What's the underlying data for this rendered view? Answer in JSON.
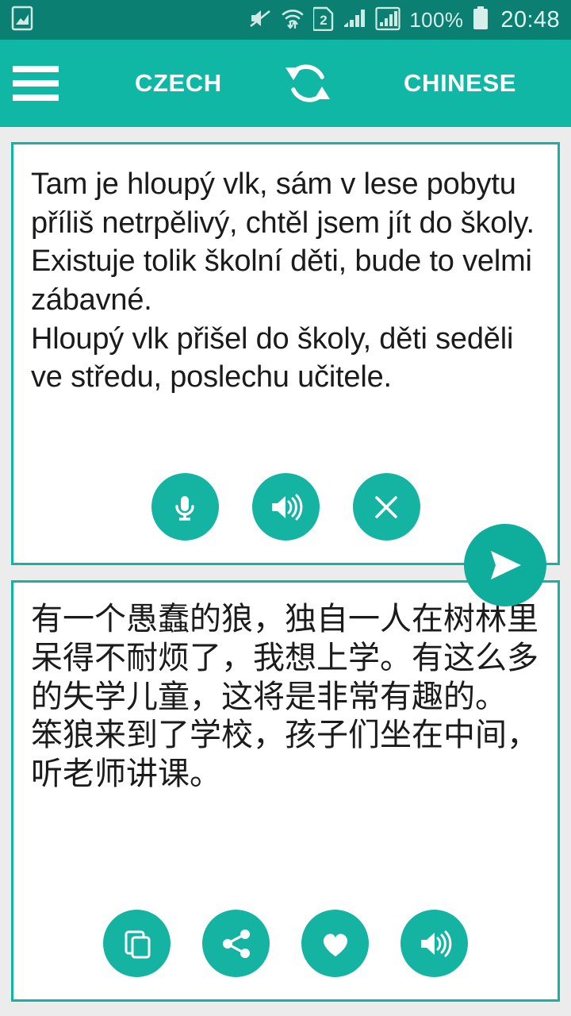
{
  "status_bar": {
    "icons": [
      {
        "name": "screenshot-icon",
        "label": "screenshot"
      },
      {
        "name": "mute-icon",
        "label": "sound muted"
      },
      {
        "name": "wifi-transfer-icon",
        "label": "wifi with data transfer"
      },
      {
        "name": "sim2-icon",
        "label": "2"
      },
      {
        "name": "signal-bars-icon",
        "label": "signal strength"
      },
      {
        "name": "signal-bars-boxed-icon",
        "label": "second signal strength"
      }
    ],
    "sim_label": "2",
    "battery_percent": "100%",
    "clock": "20:48"
  },
  "app_bar": {
    "menu_label": "Menu",
    "source_language": "CZECH",
    "target_language": "CHINESE",
    "swap_label": "Swap languages"
  },
  "source_card": {
    "text": "Tam je hloupý vlk, sám v lese pobytu příliš netrpělivý, chtěl jsem jít do školy. Existuje tolik školní děti, bude to velmi zábavné.\nHloupý vlk přišel do školy, děti seděli ve středu, poslechu učitele.",
    "actions": [
      {
        "name": "microphone-button",
        "label": "Speak"
      },
      {
        "name": "speak-button",
        "label": "Listen"
      },
      {
        "name": "clear-button",
        "label": "Clear"
      }
    ]
  },
  "target_card": {
    "text": "有一个愚蠢的狼，独自一人在树林里呆得不耐烦了，我想上学。有这么多的失学儿童，这将是非常有趣的。\n笨狼来到了学校，孩子们坐在中间，听老师讲课。",
    "actions": [
      {
        "name": "copy-button",
        "label": "Copy"
      },
      {
        "name": "share-button",
        "label": "Share"
      },
      {
        "name": "favorite-button",
        "label": "Favorite"
      },
      {
        "name": "speak-button",
        "label": "Listen"
      }
    ]
  },
  "send_button": {
    "label": "Translate"
  },
  "colors": {
    "status_bar_bg": "#0b7f72",
    "app_bar_bg": "#0fb7a4",
    "accent": "#14b3a2",
    "page_bg": "#ececec",
    "card_bg": "#ffffff",
    "text": "#1b1b1b",
    "on_accent": "#ffffff"
  }
}
